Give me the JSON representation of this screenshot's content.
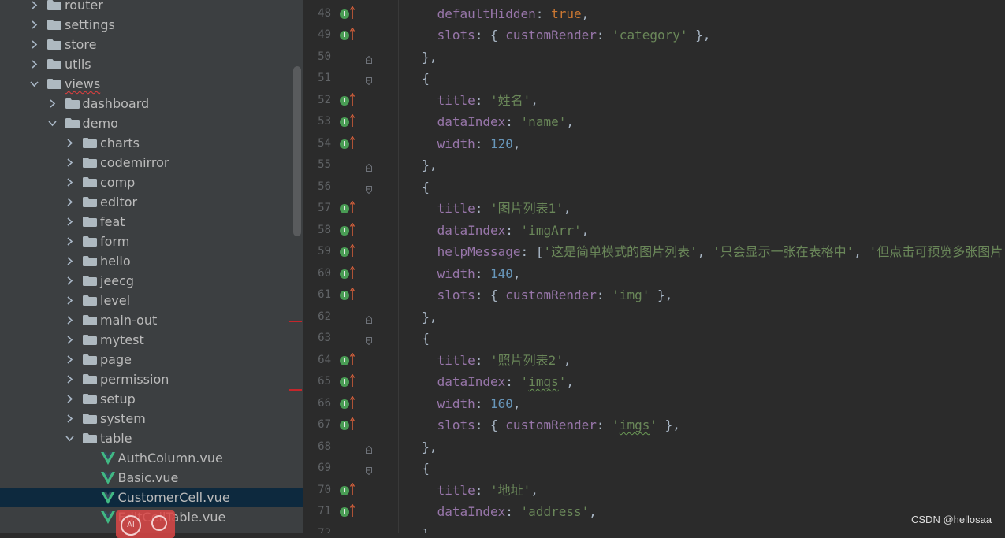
{
  "tree": {
    "items": [
      {
        "label": "router",
        "kind": "folder",
        "expanded": false
      },
      {
        "label": "settings",
        "kind": "folder",
        "expanded": false
      },
      {
        "label": "store",
        "kind": "folder",
        "expanded": false
      },
      {
        "label": "utils",
        "kind": "folder",
        "expanded": false
      },
      {
        "label": "views",
        "kind": "folder",
        "expanded": true
      },
      {
        "label": "dashboard",
        "kind": "folder",
        "expanded": false
      },
      {
        "label": "demo",
        "kind": "folder",
        "expanded": true
      },
      {
        "label": "charts",
        "kind": "folder",
        "expanded": false
      },
      {
        "label": "codemirror",
        "kind": "folder",
        "expanded": false
      },
      {
        "label": "comp",
        "kind": "folder",
        "expanded": false
      },
      {
        "label": "editor",
        "kind": "folder",
        "expanded": false
      },
      {
        "label": "feat",
        "kind": "folder",
        "expanded": false
      },
      {
        "label": "form",
        "kind": "folder",
        "expanded": false
      },
      {
        "label": "hello",
        "kind": "folder",
        "expanded": false
      },
      {
        "label": "jeecg",
        "kind": "folder",
        "expanded": false
      },
      {
        "label": "level",
        "kind": "folder",
        "expanded": false
      },
      {
        "label": "main-out",
        "kind": "folder",
        "expanded": false
      },
      {
        "label": "mytest",
        "kind": "folder",
        "expanded": false
      },
      {
        "label": "page",
        "kind": "folder",
        "expanded": false
      },
      {
        "label": "permission",
        "kind": "folder",
        "expanded": false
      },
      {
        "label": "setup",
        "kind": "folder",
        "expanded": false
      },
      {
        "label": "system",
        "kind": "folder",
        "expanded": false
      },
      {
        "label": "table",
        "kind": "folder",
        "expanded": true
      },
      {
        "label": "AuthColumn.vue",
        "kind": "vue"
      },
      {
        "label": "Basic.vue",
        "kind": "vue"
      },
      {
        "label": "CustomerCell.vue",
        "kind": "vue",
        "selected": true
      },
      {
        "label": "EditCellTable.vue",
        "kind": "vue"
      }
    ]
  },
  "editor": {
    "lines": [
      {
        "num": "48",
        "gutter": "impl",
        "text": "    defaultHidden: true,"
      },
      {
        "num": "49",
        "gutter": "impl",
        "text": "    slots: { customRender: 'category' },"
      },
      {
        "num": "50",
        "gutter": "fold-end",
        "text": "  },"
      },
      {
        "num": "51",
        "gutter": "fold-start",
        "text": "  {"
      },
      {
        "num": "52",
        "gutter": "impl",
        "text": "    title: '姓名',"
      },
      {
        "num": "53",
        "gutter": "impl",
        "text": "    dataIndex: 'name',"
      },
      {
        "num": "54",
        "gutter": "impl",
        "text": "    width: 120,"
      },
      {
        "num": "55",
        "gutter": "fold-end",
        "text": "  },"
      },
      {
        "num": "56",
        "gutter": "fold-start",
        "text": "  {"
      },
      {
        "num": "57",
        "gutter": "impl",
        "text": "    title: '图片列表1',"
      },
      {
        "num": "58",
        "gutter": "impl",
        "text": "    dataIndex: 'imgArr',"
      },
      {
        "num": "59",
        "gutter": "impl",
        "text": "    helpMessage: ['这是简单模式的图片列表', '只会显示一张在表格中', '但点击可预览多张图片'],"
      },
      {
        "num": "60",
        "gutter": "impl",
        "text": "    width: 140,"
      },
      {
        "num": "61",
        "gutter": "impl",
        "text": "    slots: { customRender: 'img' },"
      },
      {
        "num": "62",
        "gutter": "fold-end",
        "text": "  },"
      },
      {
        "num": "63",
        "gutter": "fold-start",
        "text": "  {"
      },
      {
        "num": "64",
        "gutter": "impl",
        "text": "    title: '照片列表2',"
      },
      {
        "num": "65",
        "gutter": "impl",
        "text": "    dataIndex: 'imgs',"
      },
      {
        "num": "66",
        "gutter": "impl",
        "text": "    width: 160,"
      },
      {
        "num": "67",
        "gutter": "impl",
        "text": "    slots: { customRender: 'imgs' },"
      },
      {
        "num": "68",
        "gutter": "fold-end",
        "text": "  },"
      },
      {
        "num": "69",
        "gutter": "fold-start",
        "text": "  {"
      },
      {
        "num": "70",
        "gutter": "impl",
        "text": "    title: '地址',"
      },
      {
        "num": "71",
        "gutter": "impl",
        "text": "    dataIndex: 'address',"
      },
      {
        "num": "72",
        "gutter": "none",
        "text": "  },"
      }
    ]
  },
  "floating_toolbar": {
    "ai_label": "AI"
  },
  "watermark": "CSDN @hellosaa",
  "colors": {
    "tree_bg": "#3c3f41",
    "editor_bg": "#2b2b2b",
    "selection": "#0d293e",
    "property": "#9876aa",
    "string": "#6a8759",
    "number": "#6897bb",
    "keyword": "#cc7832"
  }
}
